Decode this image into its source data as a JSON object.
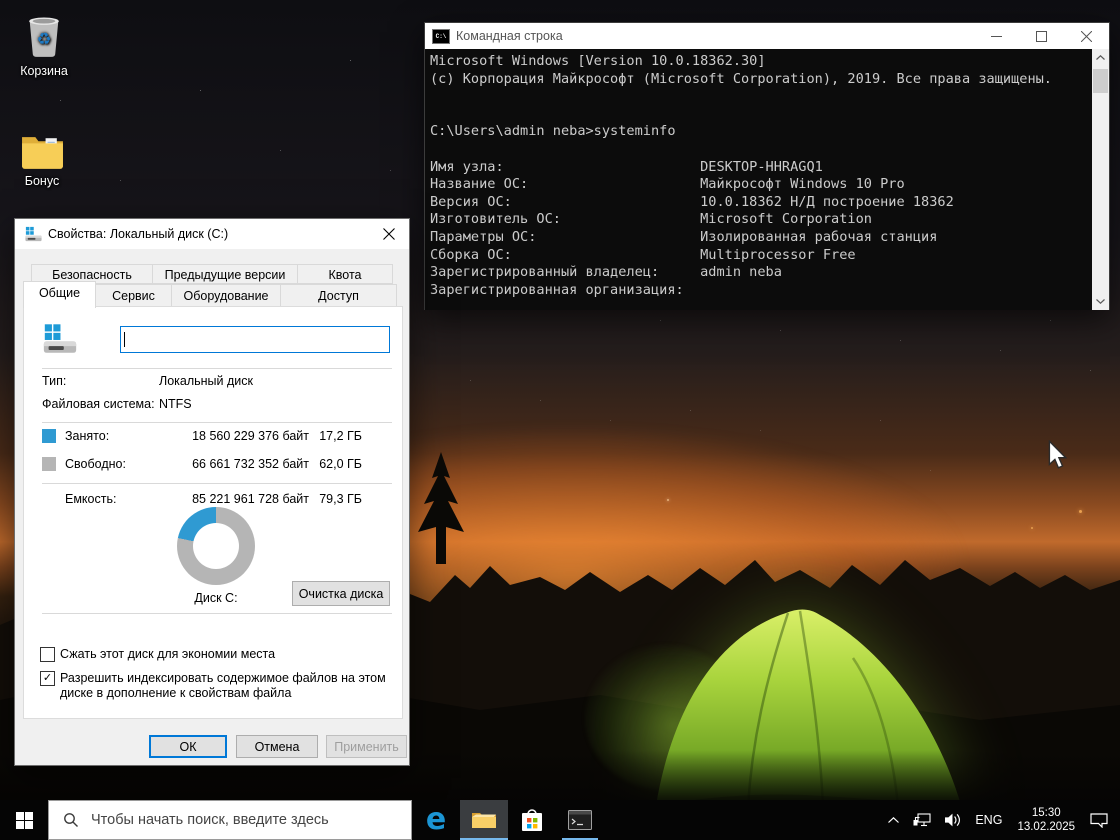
{
  "desktop": {
    "icons": [
      {
        "label": "Корзина"
      },
      {
        "label": "Бонус"
      }
    ]
  },
  "cmd_window": {
    "title": "Командная строка",
    "lines": [
      "Microsoft Windows [Version 10.0.18362.30]",
      "(с) Корпорация Майкрософт (Microsoft Corporation), 2019. Все права защищены.",
      "",
      "",
      "C:\\Users\\admin neba>systeminfo",
      "",
      "Имя узла:                        DESKTOP-HHRAGQ1",
      "Название ОС:                     Майкрософт Windows 10 Pro",
      "Версия ОС:                       10.0.18362 Н/Д построение 18362",
      "Изготовитель ОС:                 Microsoft Corporation",
      "Параметры ОС:                    Изолированная рабочая станция",
      "Сборка ОС:                       Multiprocessor Free",
      "Зарегистрированный владелец:     admin neba",
      "Зарегистрированная организация:"
    ]
  },
  "dialog": {
    "title": "Свойства: Локальный диск (C:)",
    "tabs_back": [
      "Безопасность",
      "Предыдущие версии",
      "Квота"
    ],
    "tabs_front": [
      "Общие",
      "Сервис",
      "Оборудование",
      "Доступ"
    ],
    "active_tab": "Общие",
    "volume_name_value": "",
    "fields": {
      "type_label": "Тип:",
      "type_value": "Локальный диск",
      "fs_label": "Файловая система:",
      "fs_value": "NTFS"
    },
    "usage": {
      "used_label": "Занято:",
      "used_bytes": "18 560 229 376 байт",
      "used_size": "17,2 ГБ",
      "free_label": "Свободно:",
      "free_bytes": "66 661 732 352 байт",
      "free_size": "62,0 ГБ",
      "capacity_label": "Емкость:",
      "capacity_bytes": "85 221 961 728 байт",
      "capacity_size": "79,3 ГБ",
      "used_percent": 21.7,
      "used_color": "#2f9ad2",
      "free_color": "#b5b5b5"
    },
    "disk_label": "Диск C:",
    "cleanup_button": "Очистка диска",
    "checkboxes": [
      {
        "label": "Сжать этот диск для экономии места",
        "checked": false,
        "mark": ""
      },
      {
        "label": "Разрешить индексировать содержимое файлов на этом диске в дополнение к свойствам файла",
        "checked": true,
        "mark": "✓"
      }
    ],
    "buttons": {
      "ok": "ОК",
      "cancel": "Отмена",
      "apply": "Применить"
    }
  },
  "taskbar": {
    "search_placeholder": "Чтобы начать поиск, введите здесь",
    "edge_glyph": "e",
    "tray": {
      "language": "ENG",
      "time": "15:30",
      "date": "13.02.2025"
    }
  },
  "icons": {
    "recycle_glyph": "♻",
    "cmd_titlebar_glyph": "C:\\"
  }
}
